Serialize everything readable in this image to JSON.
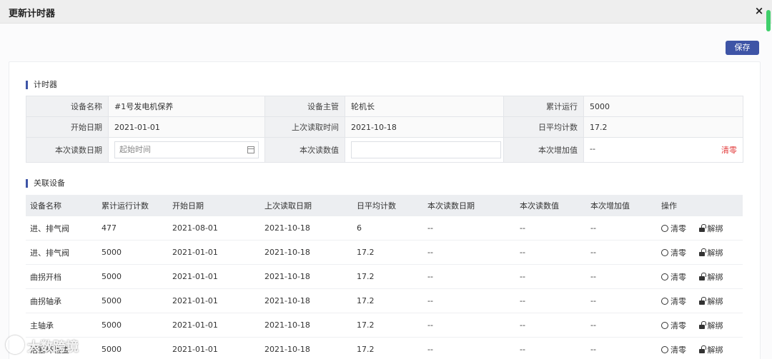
{
  "dialog": {
    "title": "更新计时器",
    "close_symbol": "×"
  },
  "toolbar": {
    "save_label": "保存"
  },
  "timer_section": {
    "title": "计时器",
    "fields": {
      "device_name_label": "设备名称",
      "device_name_value": "#1号发电机保养",
      "supervisor_label": "设备主管",
      "supervisor_value": "轮机长",
      "cumulative_label": "累计运行",
      "cumulative_value": "5000",
      "start_date_label": "开始日期",
      "start_date_value": "2021-01-01",
      "last_read_time_label": "上次读取时间",
      "last_read_time_value": "2021-10-18",
      "daily_avg_label": "日平均计数",
      "daily_avg_value": "17.2",
      "read_date_label": "本次读数日期",
      "read_date_placeholder": "起始时间",
      "read_value_label": "本次读数值",
      "increase_label": "本次增加值",
      "increase_value": "--",
      "reset_label": "清零"
    }
  },
  "related_section": {
    "title": "关联设备",
    "columns": [
      "设备名称",
      "累计运行计数",
      "开始日期",
      "上次读取日期",
      "日平均计数",
      "本次读数日期",
      "本次读数值",
      "本次增加值",
      "操作"
    ],
    "rows": [
      [
        "进、排气阀",
        "477",
        "2021-08-01",
        "2021-10-18",
        "6",
        "--",
        "--",
        "--"
      ],
      [
        "进、排气阀",
        "5000",
        "2021-01-01",
        "2021-10-18",
        "17.2",
        "--",
        "--",
        "--"
      ],
      [
        "曲拐开档",
        "5000",
        "2021-01-01",
        "2021-10-18",
        "17.2",
        "--",
        "--",
        "--"
      ],
      [
        "曲拐轴承",
        "5000",
        "2021-01-01",
        "2021-10-18",
        "17.2",
        "--",
        "--",
        "--"
      ],
      [
        "主轴承",
        "5000",
        "2021-01-01",
        "2021-10-18",
        "17.2",
        "--",
        "--",
        "--"
      ],
      [
        "活塞环检查",
        "5000",
        "2021-01-01",
        "2021-10-18",
        "17.2",
        "--",
        "--",
        "--"
      ]
    ],
    "action_reset": "清零",
    "action_unbind": "解绑"
  },
  "watermark": {
    "text": "大数跨境"
  },
  "colors": {
    "primary": "#3e54a6",
    "danger": "#e23b3b"
  }
}
